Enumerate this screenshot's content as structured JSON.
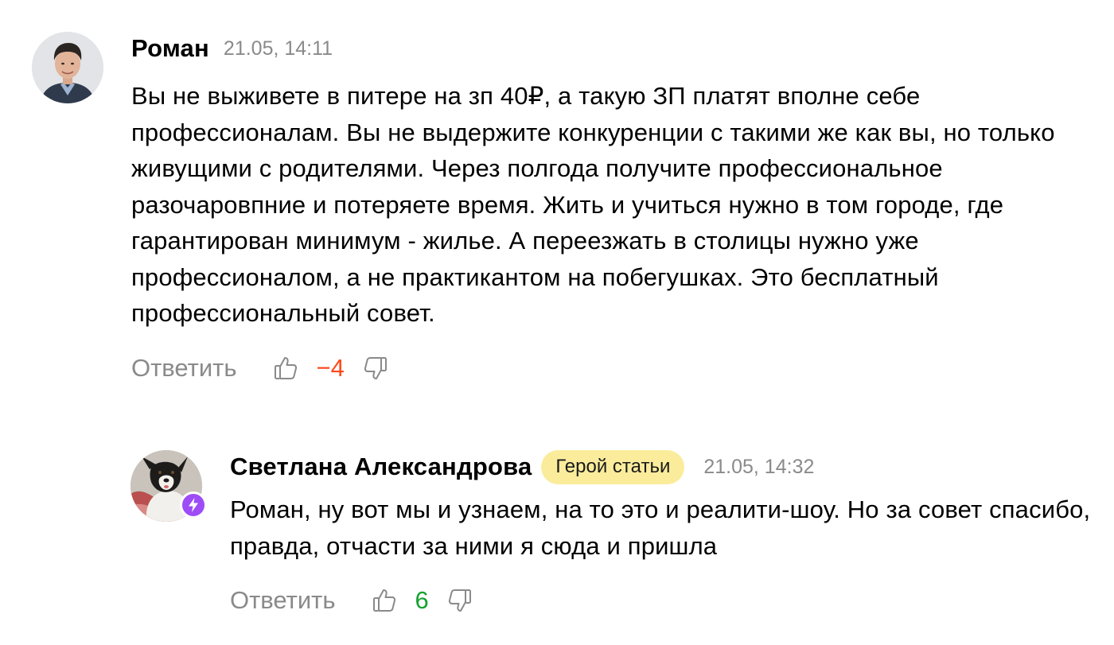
{
  "comments": [
    {
      "author": "Роман",
      "time": "21.05, 14:11",
      "text": "Вы не выживете в питере на зп 40₽, а такую ЗП платят вполне себе профессионалам. Вы не выдержите конкуренции с такими же как вы, но только живущими с родителями. Через полгода получите профессиональное разочаровпние и потеряете время. Жить и учиться нужно в том городе, где гарантирован минимум - жилье. А переезжать в столицы нужно уже профессионалом, а не практикантом на побегушках. Это бесплатный профессиональный совет.",
      "reply_label": "Ответить",
      "score": "−4",
      "score_color": "#ff4a1c"
    },
    {
      "author": "Светлана Александрова",
      "badge": "Герой статьи",
      "time": "21.05, 14:32",
      "text": "Роман, ну вот мы и узнаем, на то это и реалити-шоу. Но за совет спасибо, правда, отчасти за ними я сюда и пришла",
      "reply_label": "Ответить",
      "score": "6",
      "score_color": "#15a230"
    }
  ],
  "icons": {
    "like": "thumbs-up-icon",
    "dislike": "thumbs-down-icon",
    "hero": "lightning-icon"
  },
  "colors": {
    "badge_bg": "#fbec9c",
    "hero_badge": "#9d4cf6",
    "muted_text": "#8a8a8a"
  }
}
